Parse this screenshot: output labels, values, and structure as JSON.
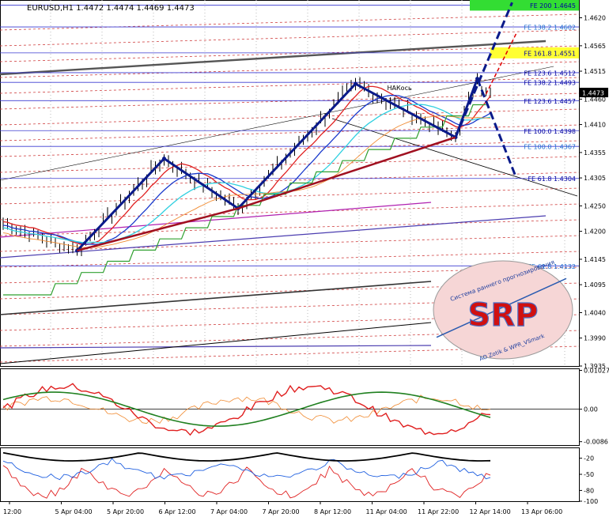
{
  "header": {
    "symbol_text": "EURUSD,H1  1.4472 1.4474 1.4469 1.4473"
  },
  "colors": {
    "background": "#ffffff",
    "text": "#000000",
    "fe_label": "#0000a0",
    "fe_label_alt": "#1e6fd0",
    "highlight_green": "#33dd33",
    "highlight_yellow": "#ffff33",
    "zigzag": "#0a1a8a",
    "trend_red": "#a01020",
    "guide_red": "#e00000",
    "price_box": "#000000"
  },
  "chart_data": [
    {
      "type": "line",
      "name": "main",
      "current_price_label": "1.4473",
      "price_axis_ticks": [
        "1.4620",
        "1.4565",
        "1.4515",
        "1.4460",
        "1.4410",
        "1.4355",
        "1.4305",
        "1.4250",
        "1.4200",
        "1.4145",
        "1.4095",
        "1.4040",
        "1.3990",
        "1.3935"
      ],
      "ylim": [
        1.3935,
        1.4655
      ],
      "time_labels": [
        "12:00",
        "5 Apr 04:00",
        "5 Apr 20:00",
        "6 Apr 12:00",
        "7 Apr 04:00",
        "7 Apr 20:00",
        "8 Apr 12:00",
        "11 Apr 04:00",
        "11 Apr 22:00",
        "12 Apr 14:00",
        "13 Apr 06:00"
      ],
      "fe_levels": [
        {
          "label": "FE 200 1.4645",
          "value": 1.4645,
          "highlight": "green"
        },
        {
          "label": "FE 138.2 1.4602",
          "value": 1.4602
        },
        {
          "label": "FE 161.8 1.4551",
          "value": 1.4551,
          "highlight": "yellow"
        },
        {
          "label": "FE 123.6 1.4512",
          "value": 1.4512
        },
        {
          "label": "FE 138.2 1.4493",
          "value": 1.4493
        },
        {
          "label": "FE 123.6 1.4457",
          "value": 1.4457
        },
        {
          "label": "FE 100.0 1.4398",
          "value": 1.4398
        },
        {
          "label": "FE 100.0 1.4367",
          "value": 1.4367
        },
        {
          "label": "FE 61.8 1.4304",
          "value": 1.4304
        },
        {
          "label": "FE 61.8 1.4132",
          "value": 1.4132
        }
      ],
      "annotation": "НАКось",
      "zigzag_points": [
        {
          "bar": 17,
          "price": 1.4162
        },
        {
          "bar": 37,
          "price": 1.4343
        },
        {
          "bar": 54,
          "price": 1.4245
        },
        {
          "bar": 81,
          "price": 1.449
        },
        {
          "bar": 104,
          "price": 1.4385
        },
        {
          "bar": 109,
          "price": 1.45
        }
      ],
      "logo": {
        "letters": "SRP",
        "top_text": "Система раннего прогнозирования",
        "bottom_text": "AO Zotik & WPR_VSmark"
      }
    },
    {
      "type": "line",
      "name": "oscillator-1",
      "price_axis_ticks": [
        "0.01027",
        "0.00",
        "-0.0086"
      ],
      "ylim": [
        -0.0095,
        0.0108
      ]
    },
    {
      "type": "line",
      "name": "oscillator-2",
      "price_axis_ticks": [
        "-20",
        "-50",
        "-80",
        "-100"
      ],
      "ylim": [
        -100,
        0
      ]
    }
  ]
}
